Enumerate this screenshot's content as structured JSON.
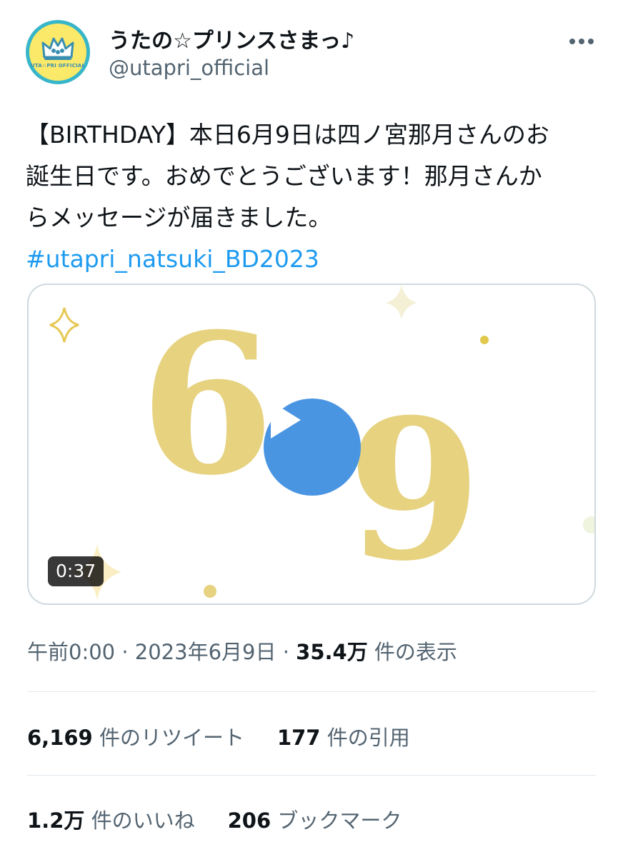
{
  "account": {
    "display_name": "うたの☆プリンスさまっ♪",
    "handle": "@utapri_official",
    "avatar_text": "UTA☆PRI OFFICIAL"
  },
  "icons": {
    "more": "more-horizontal-icon",
    "play": "play-icon",
    "avatar": "crown-logo"
  },
  "tweet": {
    "lines": [
      "【BIRTHDAY】本日6月9日は四ノ宮那月さんのお",
      "誕生日です。おめでとうございます！那月さんか",
      "らメッセージが届きました。"
    ],
    "hashtag": "#utapri_natsuki_BD2023"
  },
  "media": {
    "digits": [
      "6",
      "9"
    ],
    "duration": "0:37"
  },
  "meta": {
    "time": "午前0:00",
    "sep1": " · ",
    "date": "2023年6月9日",
    "sep2": " · ",
    "views_count": "35.4万",
    "views_label": " 件の表示"
  },
  "stats": {
    "retweets_count": "6,169",
    "retweets_label": " 件のリツイート",
    "quotes_count": "177",
    "quotes_label": " 件の引用",
    "likes_count": "1.2万",
    "likes_label": " 件のいいね",
    "bookmarks_count": "206",
    "bookmarks_label": " ブックマーク"
  },
  "colors": {
    "gold": "#e6d27f",
    "play_blue": "#4a95e2",
    "hashtag_blue": "#1d9bf0",
    "secondary_text": "#536471",
    "avatar_teal": "#38b6c9",
    "avatar_yellow": "#fbe96a"
  }
}
